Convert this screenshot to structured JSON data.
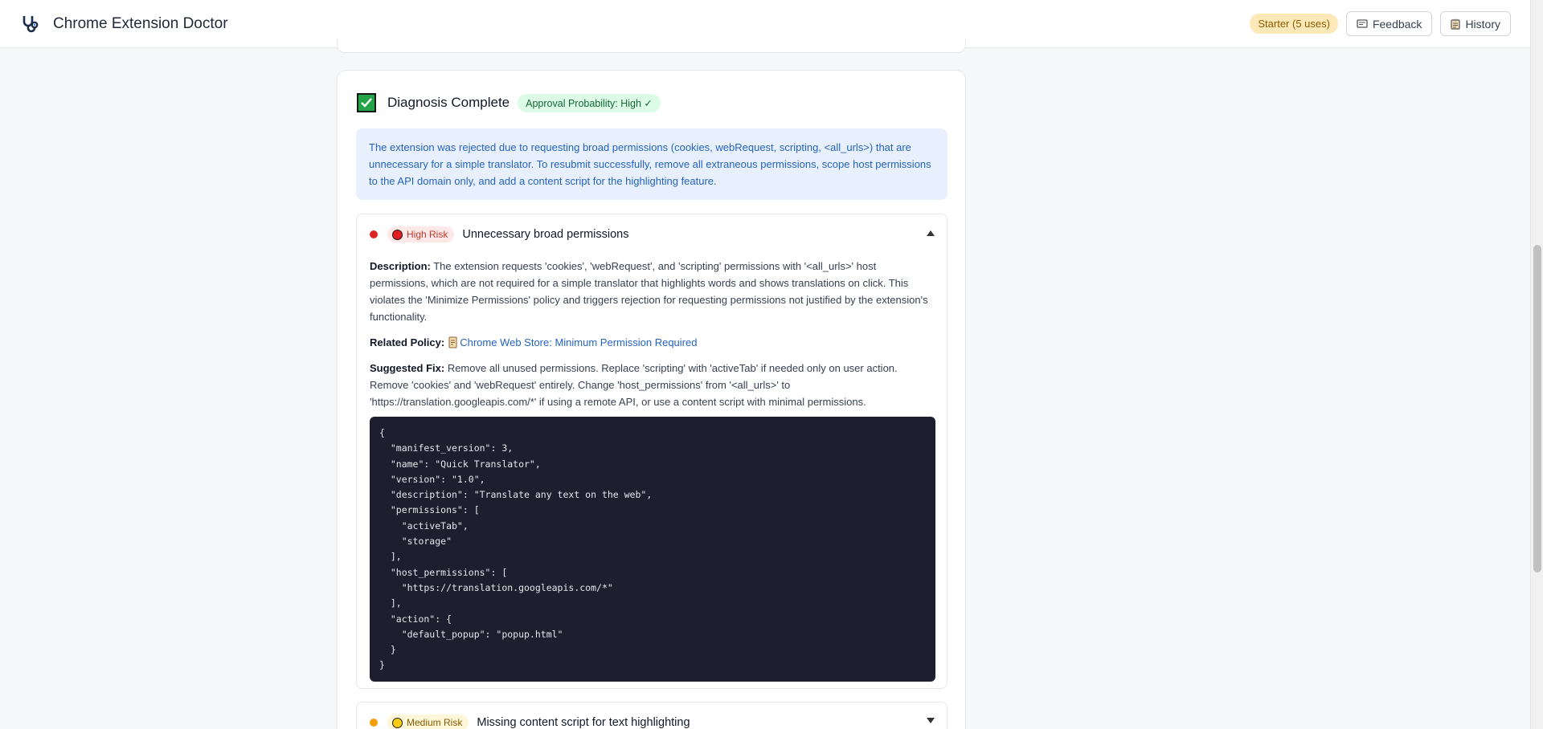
{
  "header": {
    "app_title": "Chrome Extension Doctor",
    "logo_icon": "stethoscope-icon",
    "plan_badge": "Starter (5 uses)",
    "feedback_label": "Feedback",
    "history_label": "History"
  },
  "diagnosis": {
    "title": "Diagnosis Complete",
    "approval_badge": "Approval Probability: High ✓",
    "summary": "The extension was rejected due to requesting broad permissions (cookies, webRequest, scripting, <all_urls>) that are unnecessary for a simple translator. To resubmit successfully, remove all extraneous permissions, scope host permissions to the API domain only, and add a content script for the highlighting feature."
  },
  "issues": [
    {
      "risk": "High Risk",
      "title": "Unnecessary broad permissions",
      "expanded": true,
      "description_label": "Description:",
      "description": "The extension requests 'cookies', 'webRequest', and 'scripting' permissions with '<all_urls>' host permissions, which are not required for a simple translator that highlights words and shows translations on click. This violates the 'Minimize Permissions' policy and triggers rejection for requesting permissions not justified by the extension's functionality.",
      "policy_label": "Related Policy:",
      "policy_link": "Chrome Web Store: Minimum Permission Required",
      "fix_label": "Suggested Fix:",
      "fix": "Remove all unused permissions. Replace 'scripting' with 'activeTab' if needed only on user action. Remove 'cookies' and 'webRequest' entirely. Change 'host_permissions' from '<all_urls>' to 'https://translation.googleapis.com/*' if using a remote API, or use a content script with minimal permissions.",
      "code": "{\n  \"manifest_version\": 3,\n  \"name\": \"Quick Translator\",\n  \"version\": \"1.0\",\n  \"description\": \"Translate any text on the web\",\n  \"permissions\": [\n    \"activeTab\",\n    \"storage\"\n  ],\n  \"host_permissions\": [\n    \"https://translation.googleapis.com/*\"\n  ],\n  \"action\": {\n    \"default_popup\": \"popup.html\"\n  }\n}"
    },
    {
      "risk": "Medium Risk",
      "title": "Missing content script for text highlighting",
      "expanded": false
    }
  ],
  "colors": {
    "high_risk_dot": "#dc2626",
    "medium_risk_dot": "#f59e0b",
    "success": "#22a447",
    "link": "#2563be"
  }
}
